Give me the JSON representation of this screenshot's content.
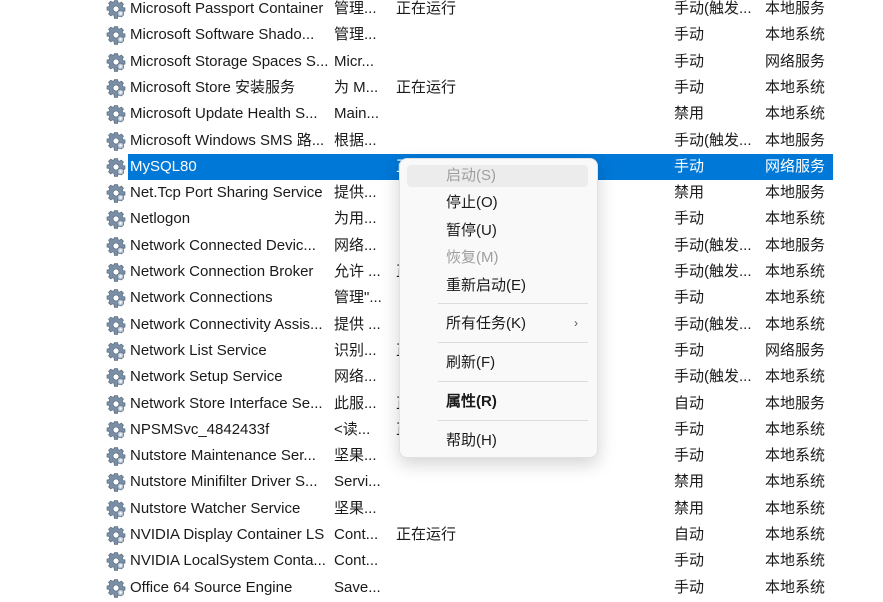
{
  "services": [
    {
      "name": "Microsoft Passport Container",
      "desc": "管理...",
      "status": "正在运行",
      "startup": "手动(触发...",
      "logon": "本地服务"
    },
    {
      "name": "Microsoft Software Shado...",
      "desc": "管理...",
      "status": "",
      "startup": "手动",
      "logon": "本地系统"
    },
    {
      "name": "Microsoft Storage Spaces S...",
      "desc": "Micr...",
      "status": "",
      "startup": "手动",
      "logon": "网络服务"
    },
    {
      "name": "Microsoft Store 安装服务",
      "desc": "为 M...",
      "status": "正在运行",
      "startup": "手动",
      "logon": "本地系统"
    },
    {
      "name": "Microsoft Update Health S...",
      "desc": "Main...",
      "status": "",
      "startup": "禁用",
      "logon": "本地系统"
    },
    {
      "name": "Microsoft Windows SMS 路...",
      "desc": "根据...",
      "status": "",
      "startup": "手动(触发...",
      "logon": "本地服务"
    },
    {
      "name": "MySQL80",
      "desc": "",
      "status": "正",
      "startup": "手动",
      "logon": "网络服务",
      "selected": true
    },
    {
      "name": "Net.Tcp Port Sharing Service",
      "desc": "提供...",
      "status": "",
      "startup": "禁用",
      "logon": "本地服务"
    },
    {
      "name": "Netlogon",
      "desc": "为用...",
      "status": "",
      "startup": "手动",
      "logon": "本地系统"
    },
    {
      "name": "Network Connected Devic...",
      "desc": "网络...",
      "status": "",
      "startup": "手动(触发...",
      "logon": "本地服务"
    },
    {
      "name": "Network Connection Broker",
      "desc": "允许 ...",
      "status": "正",
      "startup": "手动(触发...",
      "logon": "本地系统"
    },
    {
      "name": "Network Connections",
      "desc": "管理\"...",
      "status": "",
      "startup": "手动",
      "logon": "本地系统"
    },
    {
      "name": "Network Connectivity Assis...",
      "desc": "提供 ...",
      "status": "",
      "startup": "手动(触发...",
      "logon": "本地系统"
    },
    {
      "name": "Network List Service",
      "desc": "识别...",
      "status": "正",
      "startup": "手动",
      "logon": "网络服务"
    },
    {
      "name": "Network Setup Service",
      "desc": "网络...",
      "status": "",
      "startup": "手动(触发...",
      "logon": "本地系统"
    },
    {
      "name": "Network Store Interface Se...",
      "desc": "此服...",
      "status": "正",
      "startup": "自动",
      "logon": "本地服务"
    },
    {
      "name": "NPSMSvc_4842433f",
      "desc": "<读...",
      "status": "正",
      "startup": "手动",
      "logon": "本地系统"
    },
    {
      "name": "Nutstore Maintenance Ser...",
      "desc": "坚果...",
      "status": "",
      "startup": "手动",
      "logon": "本地系统"
    },
    {
      "name": "Nutstore Minifilter Driver S...",
      "desc": "Servi...",
      "status": "",
      "startup": "禁用",
      "logon": "本地系统"
    },
    {
      "name": "Nutstore Watcher Service",
      "desc": "坚果...",
      "status": "",
      "startup": "禁用",
      "logon": "本地系统"
    },
    {
      "name": "NVIDIA Display Container LS",
      "desc": "Cont...",
      "status": "正在运行",
      "startup": "自动",
      "logon": "本地系统"
    },
    {
      "name": "NVIDIA LocalSystem Conta...",
      "desc": "Cont...",
      "status": "",
      "startup": "手动",
      "logon": "本地系统"
    },
    {
      "name": "Office 64 Source Engine",
      "desc": "Save...",
      "status": "",
      "startup": "手动",
      "logon": "本地系统"
    }
  ],
  "context_menu": {
    "start": "启动(S)",
    "stop": "停止(O)",
    "pause": "暂停(U)",
    "resume": "恢复(M)",
    "restart": "重新启动(E)",
    "all_tasks": "所有任务(K)",
    "refresh": "刷新(F)",
    "properties": "属性(R)",
    "help": "帮助(H)",
    "submenu_arrow": "›"
  },
  "colors": {
    "selection": "#0078d7",
    "menu_bg": "#f9f9f9"
  }
}
